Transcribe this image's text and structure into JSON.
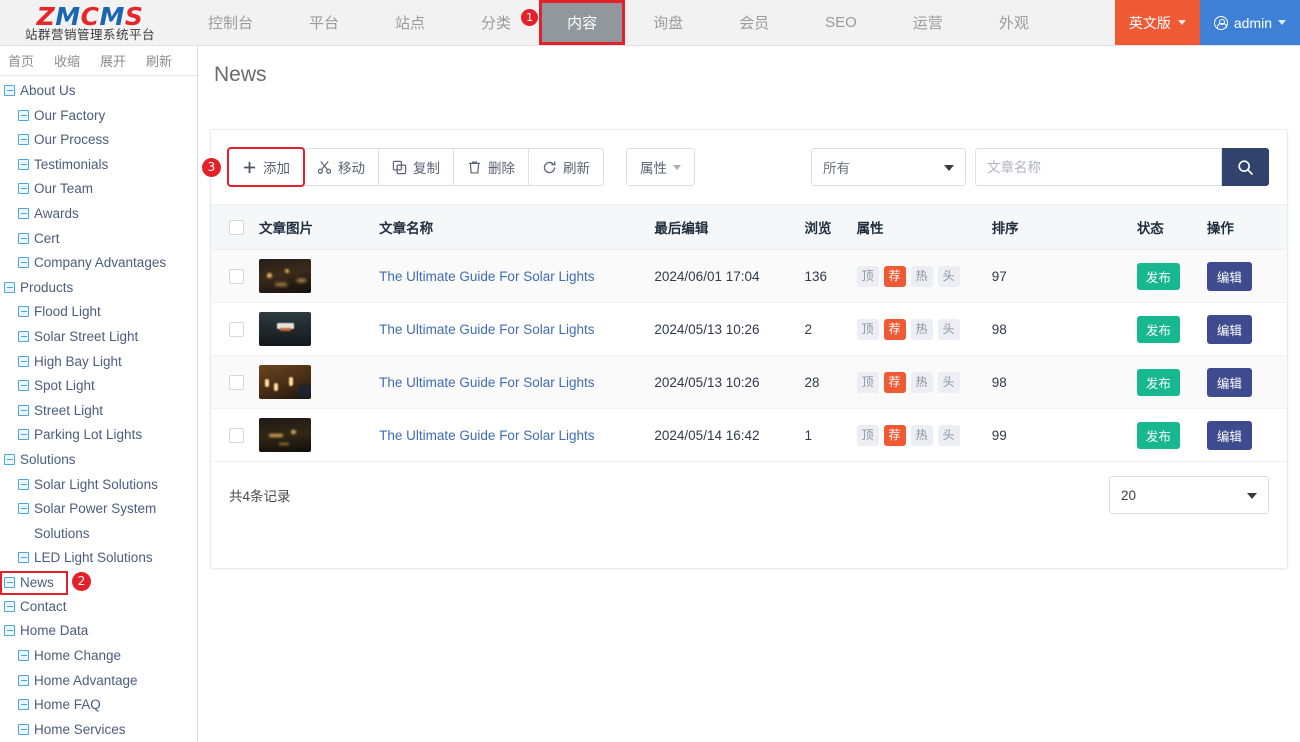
{
  "brand": {
    "logo_text": "ZMCMS",
    "logo_letters": [
      {
        "ch": "Z",
        "color": "#e8262a"
      },
      {
        "ch": "M",
        "color": "#1b66b3"
      },
      {
        "ch": "C",
        "color": "#e8262a"
      },
      {
        "ch": "M",
        "color": "#1b66b3"
      },
      {
        "ch": "S",
        "color": "#e8262a"
      }
    ],
    "logo_subtitle": "站群营销管理系统平台"
  },
  "topnav": {
    "items": [
      {
        "label": "控制台",
        "active": false,
        "badge": ""
      },
      {
        "label": "平台",
        "active": false,
        "badge": ""
      },
      {
        "label": "站点",
        "active": false,
        "badge": ""
      },
      {
        "label": "分类",
        "active": false,
        "badge": "1"
      },
      {
        "label": "内容",
        "active": true,
        "badge": ""
      },
      {
        "label": "询盘",
        "active": false,
        "badge": ""
      },
      {
        "label": "会员",
        "active": false,
        "badge": ""
      },
      {
        "label": "SEO",
        "active": false,
        "badge": ""
      },
      {
        "label": "运营",
        "active": false,
        "badge": ""
      },
      {
        "label": "外观",
        "active": false,
        "badge": ""
      }
    ],
    "language_label": "英文版",
    "user_label": "admin",
    "active_color": "#90989e",
    "highlight_color": "#e4202a",
    "language_bg": "#ef5a35",
    "user_bg": "#3f80d7"
  },
  "sidebar": {
    "tools": [
      {
        "label": "首页"
      },
      {
        "label": "收缩"
      },
      {
        "label": "展开"
      },
      {
        "label": "刷新"
      }
    ],
    "tree": [
      {
        "label": "About Us",
        "level": 1,
        "selected": false,
        "badge": ""
      },
      {
        "label": "Our Factory",
        "level": 2,
        "selected": false,
        "badge": ""
      },
      {
        "label": "Our Process",
        "level": 2,
        "selected": false,
        "badge": ""
      },
      {
        "label": "Testimonials",
        "level": 2,
        "selected": false,
        "badge": ""
      },
      {
        "label": "Our Team",
        "level": 2,
        "selected": false,
        "badge": ""
      },
      {
        "label": "Awards",
        "level": 2,
        "selected": false,
        "badge": ""
      },
      {
        "label": "Cert",
        "level": 2,
        "selected": false,
        "badge": ""
      },
      {
        "label": "Company Advantages",
        "level": 2,
        "selected": false,
        "badge": ""
      },
      {
        "label": "Products",
        "level": 1,
        "selected": false,
        "badge": ""
      },
      {
        "label": "Flood Light",
        "level": 2,
        "selected": false,
        "badge": ""
      },
      {
        "label": "Solar Street Light",
        "level": 2,
        "selected": false,
        "badge": ""
      },
      {
        "label": "High Bay Light",
        "level": 2,
        "selected": false,
        "badge": ""
      },
      {
        "label": "Spot Light",
        "level": 2,
        "selected": false,
        "badge": ""
      },
      {
        "label": "Street Light",
        "level": 2,
        "selected": false,
        "badge": ""
      },
      {
        "label": "Parking Lot Lights",
        "level": 2,
        "selected": false,
        "badge": ""
      },
      {
        "label": "Solutions",
        "level": 1,
        "selected": false,
        "badge": ""
      },
      {
        "label": "Solar Light Solutions",
        "level": 2,
        "selected": false,
        "badge": ""
      },
      {
        "label": "Solar Power System Solutions",
        "level": 2,
        "selected": false,
        "badge": ""
      },
      {
        "label": "LED Light Solutions",
        "level": 2,
        "selected": false,
        "badge": ""
      },
      {
        "label": "News",
        "level": 1,
        "selected": true,
        "badge": "2"
      },
      {
        "label": "Contact",
        "level": 1,
        "selected": false,
        "badge": ""
      },
      {
        "label": "Home Data",
        "level": 1,
        "selected": false,
        "badge": ""
      },
      {
        "label": "Home Change",
        "level": 2,
        "selected": false,
        "badge": ""
      },
      {
        "label": "Home Advantage",
        "level": 2,
        "selected": false,
        "badge": ""
      },
      {
        "label": "Home FAQ",
        "level": 2,
        "selected": false,
        "badge": ""
      },
      {
        "label": "Home Services",
        "level": 2,
        "selected": false,
        "badge": ""
      }
    ]
  },
  "main": {
    "page_title": "News",
    "toolbar": {
      "add_badge": "3",
      "buttons": [
        {
          "label": "添加",
          "icon": "plus-icon",
          "highlighted": true
        },
        {
          "label": "移动",
          "icon": "scissors-icon",
          "highlighted": false
        },
        {
          "label": "复制",
          "icon": "copy-icon",
          "highlighted": false
        },
        {
          "label": "删除",
          "icon": "trash-icon",
          "highlighted": false
        },
        {
          "label": "刷新",
          "icon": "refresh-icon",
          "highlighted": false
        }
      ],
      "properties_label": "属性"
    },
    "search": {
      "scope_value": "所有",
      "input_value": "",
      "placeholder": "文章名称",
      "button_icon": "search-icon",
      "button_bg": "#31426b"
    },
    "table": {
      "headers": [
        "文章图片",
        "文章名称",
        "最后编辑",
        "浏览",
        "属性",
        "排序",
        "状态",
        "操作"
      ],
      "attribute_keys": [
        "顶",
        "荐",
        "热",
        "头"
      ],
      "rows": [
        {
          "thumb": "night-street-lights-1",
          "name": "The Ultimate Guide For Solar Lights",
          "last_edit": "2024/06/01 17:04",
          "views": "136",
          "attrs": [
            false,
            true,
            false,
            false
          ],
          "sort": "97",
          "status": "发布",
          "action": "编辑"
        },
        {
          "thumb": "night-tunnel-sign-2",
          "name": "The Ultimate Guide For Solar Lights",
          "last_edit": "2024/05/13 10:26",
          "views": "2",
          "attrs": [
            false,
            true,
            false,
            false
          ],
          "sort": "98",
          "status": "发布",
          "action": "编辑"
        },
        {
          "thumb": "warm-lamp-interior-3",
          "name": "The Ultimate Guide For Solar Lights",
          "last_edit": "2024/05/13 10:26",
          "views": "28",
          "attrs": [
            false,
            true,
            false,
            false
          ],
          "sort": "98",
          "status": "发布",
          "action": "编辑"
        },
        {
          "thumb": "night-street-lights-4",
          "name": "The Ultimate Guide For Solar Lights",
          "last_edit": "2024/05/14 16:42",
          "views": "1",
          "attrs": [
            false,
            true,
            false,
            false
          ],
          "sort": "99",
          "status": "发布",
          "action": "编辑"
        }
      ]
    },
    "footer": {
      "record_count_text": "共4条记录",
      "page_size": "20"
    }
  },
  "colors": {
    "accent_red": "#e4202a",
    "accent_orange": "#ef5a35",
    "link_blue": "#3f6cb5",
    "publish_green": "#17b890",
    "edit_purple": "#3f4b8f",
    "tree_blue": "#4a5d7e"
  }
}
